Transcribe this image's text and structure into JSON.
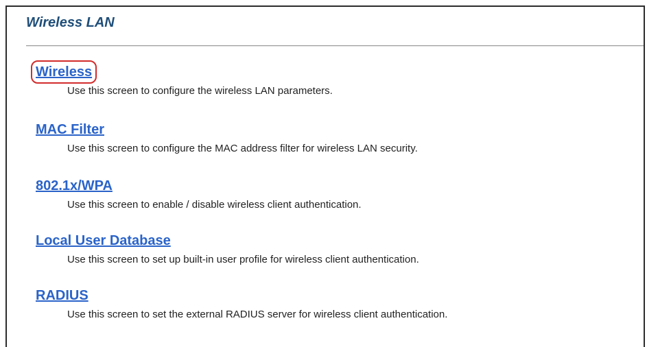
{
  "header": {
    "title": "Wireless LAN"
  },
  "menu": [
    {
      "label": "Wireless",
      "description": "Use this screen to configure the wireless LAN parameters.",
      "highlighted": true
    },
    {
      "label": "MAC Filter",
      "description": "Use this screen to configure the MAC address filter for wireless LAN security.",
      "highlighted": false
    },
    {
      "label": "802.1x/WPA",
      "description": "Use this screen to enable / disable wireless client authentication.",
      "highlighted": false
    },
    {
      "label": "Local User Database",
      "description": "Use this screen to set up built-in user profile for wireless client authentication.",
      "highlighted": false
    },
    {
      "label": "RADIUS",
      "description": "Use this screen to set the external RADIUS server for wireless client authentication.",
      "highlighted": false
    }
  ],
  "colors": {
    "title": "#1f4e79",
    "link": "#2a63c9",
    "highlight_outline": "#d22b2b",
    "description_text": "#222222"
  }
}
